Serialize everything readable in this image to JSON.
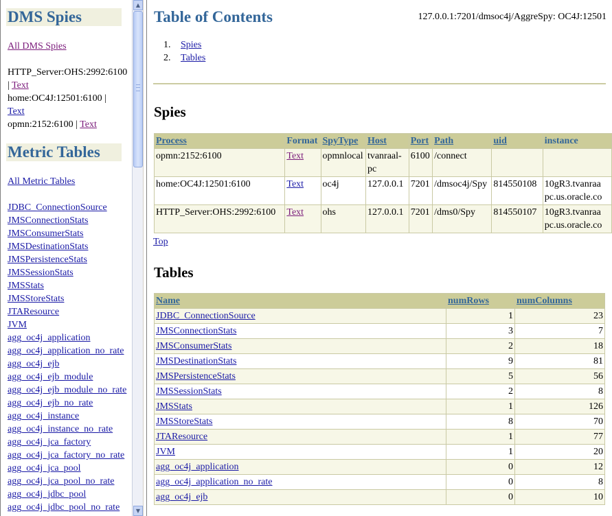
{
  "left": {
    "dms_heading": "DMS Spies",
    "all_spies": "All DMS Spies",
    "spies": [
      {
        "name": "HTTP_Server:OHS:2992:6100",
        "sep": "|",
        "link": "Text"
      },
      {
        "name": "home:OC4J:12501:6100",
        "sep": "|",
        "link": "Text"
      },
      {
        "name": "opmn:2152:6100",
        "sep": "|",
        "link": "Text"
      }
    ],
    "metric_heading": "Metric Tables",
    "all_metric_tables": "All Metric Tables",
    "metric_links": [
      "JDBC_ConnectionSource",
      "JMSConnectionStats",
      "JMSConsumerStats",
      "JMSDestinationStats",
      "JMSPersistenceStats",
      "JMSSessionStats",
      "JMSStats",
      "JMSStoreStats",
      "JTAResource",
      "JVM",
      "agg_oc4j_application",
      "agg_oc4j_application_no_rate",
      "agg_oc4j_ejb",
      "agg_oc4j_ejb_module",
      "agg_oc4j_ejb_module_no_rate",
      "agg_oc4j_ejb_no_rate",
      "agg_oc4j_instance",
      "agg_oc4j_instance_no_rate",
      "agg_oc4j_jca_factory",
      "agg_oc4j_jca_factory_no_rate",
      "agg_oc4j_jca_pool",
      "agg_oc4j_jca_pool_no_rate",
      "agg_oc4j_jdbc_pool",
      "agg_oc4j_jdbc_pool_no_rate"
    ]
  },
  "main": {
    "title": "Table of Contents",
    "server_path": "127.0.0.1:7201/dmsoc4j/AggreSpy: OC4J:12501",
    "toc": [
      {
        "num": "1.",
        "label": "Spies"
      },
      {
        "num": "2.",
        "label": "Tables"
      }
    ],
    "spies_title": "Spies",
    "spies_headers": {
      "process": "Process",
      "format": "Format",
      "spytype": "SpyType",
      "host": "Host",
      "port": "Port",
      "path": "Path",
      "uid": "uid",
      "instance": "instance"
    },
    "spies_rows": [
      {
        "process": "opmn:2152:6100",
        "format": "Text",
        "spytype": "opmnlocal",
        "host1": "tvanraal-",
        "host2": "pc",
        "port": "6100",
        "path": "/connect",
        "uid": "",
        "inst1": "",
        "inst2": ""
      },
      {
        "process": "home:OC4J:12501:6100",
        "format": "Text",
        "spytype": "oc4j",
        "host1": "127.0.0.1",
        "host2": "",
        "port": "7201",
        "path": "/dmsoc4j/Spy",
        "uid": "814550108",
        "inst1": "10gR3.tvanraa",
        "inst2": "pc.us.oracle.co"
      },
      {
        "process": "HTTP_Server:OHS:2992:6100",
        "format": "Text",
        "spytype": "ohs",
        "host1": "127.0.0.1",
        "host2": "",
        "port": "7201",
        "path": "/dms0/Spy",
        "uid": "814550107",
        "inst1": "10gR3.tvanraa",
        "inst2": "pc.us.oracle.co"
      }
    ],
    "top_link": "Top",
    "tables_title": "Tables",
    "tables_headers": {
      "name": "Name",
      "rows": "numRows",
      "cols": "numColumns"
    },
    "tables_rows": [
      {
        "name": "JDBC_ConnectionSource",
        "rows": "1",
        "cols": "23"
      },
      {
        "name": "JMSConnectionStats",
        "rows": "3",
        "cols": "7"
      },
      {
        "name": "JMSConsumerStats",
        "rows": "2",
        "cols": "18"
      },
      {
        "name": "JMSDestinationStats",
        "rows": "9",
        "cols": "81"
      },
      {
        "name": "JMSPersistenceStats",
        "rows": "5",
        "cols": "56"
      },
      {
        "name": "JMSSessionStats",
        "rows": "2",
        "cols": "8"
      },
      {
        "name": "JMSStats",
        "rows": "1",
        "cols": "126"
      },
      {
        "name": "JMSStoreStats",
        "rows": "8",
        "cols": "70"
      },
      {
        "name": "JTAResource",
        "rows": "1",
        "cols": "77"
      },
      {
        "name": "JVM",
        "rows": "1",
        "cols": "20"
      },
      {
        "name": "agg_oc4j_application",
        "rows": "0",
        "cols": "12"
      },
      {
        "name": "agg_oc4j_application_no_rate",
        "rows": "0",
        "cols": "8"
      },
      {
        "name": "agg_oc4j_ejb",
        "rows": "0",
        "cols": "10"
      }
    ]
  },
  "colors": {
    "heading_blue": "#336699",
    "header_olive": "#cccc99",
    "band": "#f7f7e7",
    "link": "#1a1aa6",
    "visited": "#7a1a7a"
  },
  "icons": {
    "scroll_up": "triangle-up-icon",
    "scroll_down": "triangle-down-icon"
  }
}
